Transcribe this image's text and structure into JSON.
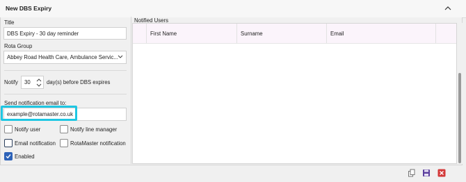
{
  "header": {
    "title": "New DBS Expiry"
  },
  "form": {
    "title_label": "Title",
    "title_value": "DBS Expiry - 30 day reminder",
    "rota_label": "Rota Group",
    "rota_value": "Abbey Road Health Care, Ambulance Servic...",
    "notify_prefix": "Notify",
    "notify_days": "30",
    "notify_suffix": "day(s) before DBS expires",
    "email_label": "Send notification email to:",
    "email_value": "example@rotamaster.co.uk",
    "checkboxes": [
      {
        "label": "Notify user",
        "checked": false
      },
      {
        "label": "Notify line manager",
        "checked": false
      },
      {
        "label": "Email notification",
        "checked": false
      },
      {
        "label": "RotaMaster notification",
        "checked": false
      },
      {
        "label": "Enabled",
        "checked": true
      }
    ]
  },
  "notified_users": {
    "title": "Notified Users",
    "columns": [
      "First Name",
      "Surname",
      "Email"
    ]
  },
  "icons": {
    "collapse": "chevron-up-icon",
    "copy": "copy-icon",
    "save": "save-icon",
    "close": "close-icon"
  },
  "colors": {
    "highlight": "#1ec7e3",
    "enabled_checkbox": "#2d62b8",
    "close_icon": "#d33a3a"
  }
}
